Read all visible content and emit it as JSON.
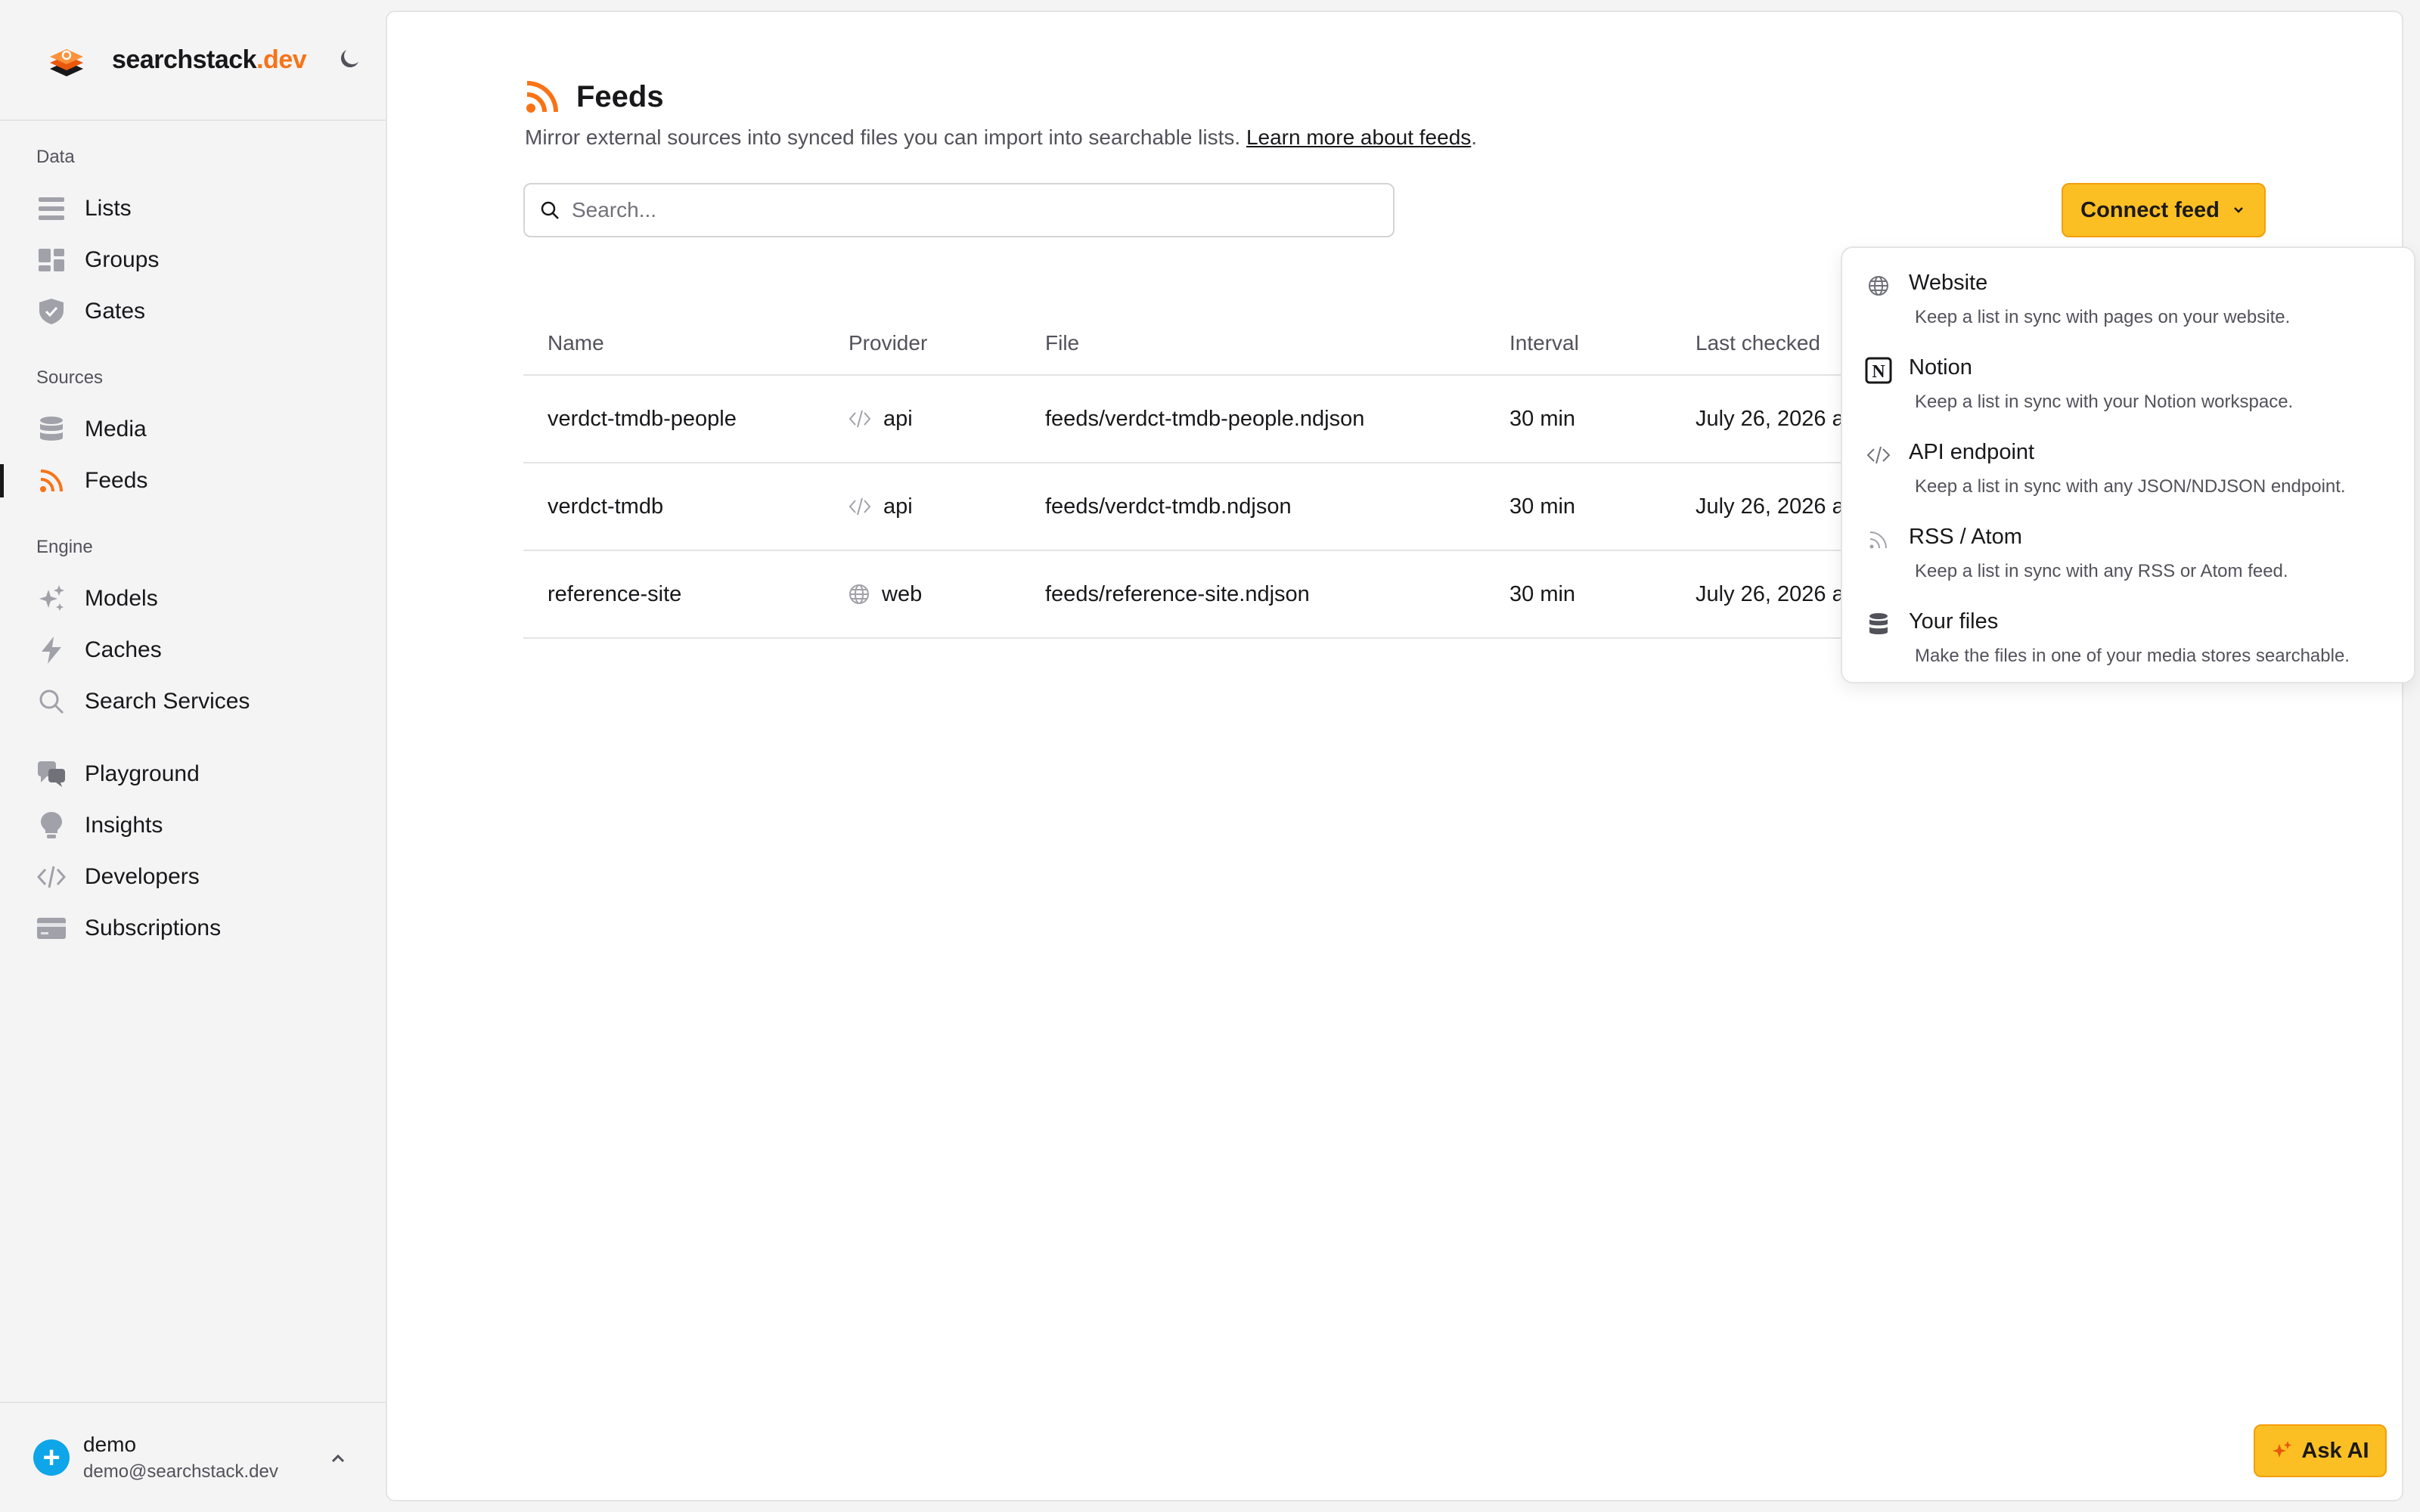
{
  "brand": {
    "name_main": "searchstack",
    "name_accent": ".dev"
  },
  "sidebar": {
    "sections": [
      {
        "label": "Data"
      },
      {
        "label": "Sources"
      },
      {
        "label": "Engine"
      }
    ],
    "items": [
      {
        "label": "Lists",
        "icon": "list-icon"
      },
      {
        "label": "Groups",
        "icon": "groups-icon"
      },
      {
        "label": "Gates",
        "icon": "shield-icon"
      },
      {
        "label": "Media",
        "icon": "database-icon"
      },
      {
        "label": "Feeds",
        "icon": "rss-icon",
        "active": true
      },
      {
        "label": "Models",
        "icon": "sparkles-icon"
      },
      {
        "label": "Caches",
        "icon": "bolt-icon"
      },
      {
        "label": "Search Services",
        "icon": "search-icon"
      },
      {
        "label": "Playground",
        "icon": "chat-icon"
      },
      {
        "label": "Insights",
        "icon": "lightbulb-icon"
      },
      {
        "label": "Developers",
        "icon": "code-icon"
      },
      {
        "label": "Subscriptions",
        "icon": "credit-card-icon"
      }
    ]
  },
  "user": {
    "name": "demo",
    "email": "demo@searchstack.dev"
  },
  "page": {
    "title": "Feeds",
    "subtitle": "Mirror external sources into synced files you can import into searchable lists.",
    "learn_more": "Learn more about feeds",
    "subtitle_end": "."
  },
  "search": {
    "placeholder": "Search..."
  },
  "connect_button": {
    "label": "Connect feed"
  },
  "table": {
    "columns": [
      "Name",
      "Provider",
      "File",
      "Interval",
      "Last checked"
    ],
    "rows": [
      {
        "name": "verdct-tmdb-people",
        "provider": "api",
        "provider_icon": "code-icon",
        "file": "feeds/verdct-tmdb-people.ndjson",
        "interval": "30 min",
        "last_checked": "July 26, 2026 a"
      },
      {
        "name": "verdct-tmdb",
        "provider": "api",
        "provider_icon": "code-icon",
        "file": "feeds/verdct-tmdb.ndjson",
        "interval": "30 min",
        "last_checked": "July 26, 2026 a"
      },
      {
        "name": "reference-site",
        "provider": "web",
        "provider_icon": "globe-icon",
        "file": "feeds/reference-site.ndjson",
        "interval": "30 min",
        "last_checked": "July 26, 2026 a"
      }
    ]
  },
  "dropdown": {
    "items": [
      {
        "title": "Website",
        "desc": "Keep a list in sync with pages on your website.",
        "icon": "globe-icon"
      },
      {
        "title": "Notion",
        "desc": "Keep a list in sync with your Notion workspace.",
        "icon": "notion-icon"
      },
      {
        "title": "API endpoint",
        "desc": "Keep a list in sync with any JSON/NDJSON endpoint.",
        "icon": "code-icon"
      },
      {
        "title": "RSS / Atom",
        "desc": "Keep a list in sync with any RSS or Atom feed.",
        "icon": "rss-icon"
      },
      {
        "title": "Your files",
        "desc": "Make the files in one of your media stores searchable.",
        "icon": "database-icon"
      }
    ]
  },
  "ask_ai": {
    "label": "Ask AI"
  },
  "colors": {
    "accent": "#f97316",
    "button": "#fbbf24"
  }
}
